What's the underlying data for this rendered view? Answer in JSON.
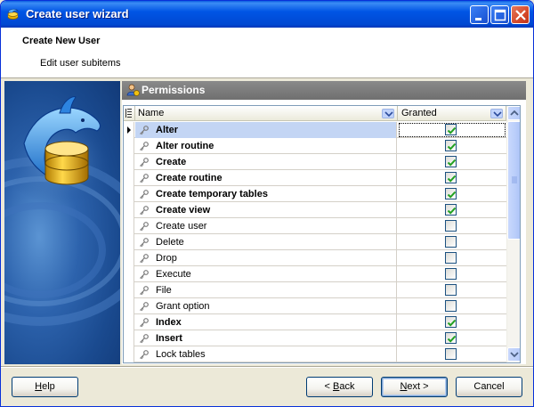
{
  "window": {
    "title": "Create user wizard",
    "icon": "dolphin-db-icon",
    "controls": [
      "minimize",
      "maximize",
      "close"
    ]
  },
  "header": {
    "title": "Create New User",
    "subtitle": "Edit user subitems"
  },
  "panel": {
    "title": "Permissions",
    "icon": "user-permissions-icon"
  },
  "grid": {
    "columns": [
      {
        "label": "Name"
      },
      {
        "label": "Granted"
      }
    ],
    "rows": [
      {
        "name": "Alter",
        "granted": true,
        "bold": true,
        "selected": true
      },
      {
        "name": "Alter routine",
        "granted": true,
        "bold": true
      },
      {
        "name": "Create",
        "granted": true,
        "bold": true
      },
      {
        "name": "Create routine",
        "granted": true,
        "bold": true
      },
      {
        "name": "Create temporary tables",
        "granted": true,
        "bold": true
      },
      {
        "name": "Create view",
        "granted": true,
        "bold": true
      },
      {
        "name": "Create user",
        "granted": false,
        "bold": false
      },
      {
        "name": "Delete",
        "granted": false,
        "bold": false
      },
      {
        "name": "Drop",
        "granted": false,
        "bold": false
      },
      {
        "name": "Execute",
        "granted": false,
        "bold": false
      },
      {
        "name": "File",
        "granted": false,
        "bold": false
      },
      {
        "name": "Grant option",
        "granted": false,
        "bold": false
      },
      {
        "name": "Index",
        "granted": true,
        "bold": true
      },
      {
        "name": "Insert",
        "granted": true,
        "bold": true
      },
      {
        "name": "Lock tables",
        "granted": false,
        "bold": false
      }
    ]
  },
  "buttons": {
    "help": {
      "pre": "",
      "accel": "H",
      "post": "elp"
    },
    "back": {
      "pre": "< ",
      "accel": "B",
      "post": "ack"
    },
    "next": {
      "pre": "",
      "accel": "N",
      "post": "ext >"
    },
    "cancel": {
      "label": "Cancel"
    }
  },
  "colors": {
    "titlebar": "#0055e5",
    "selection": "#c3d5f4",
    "check": "#21a121"
  }
}
